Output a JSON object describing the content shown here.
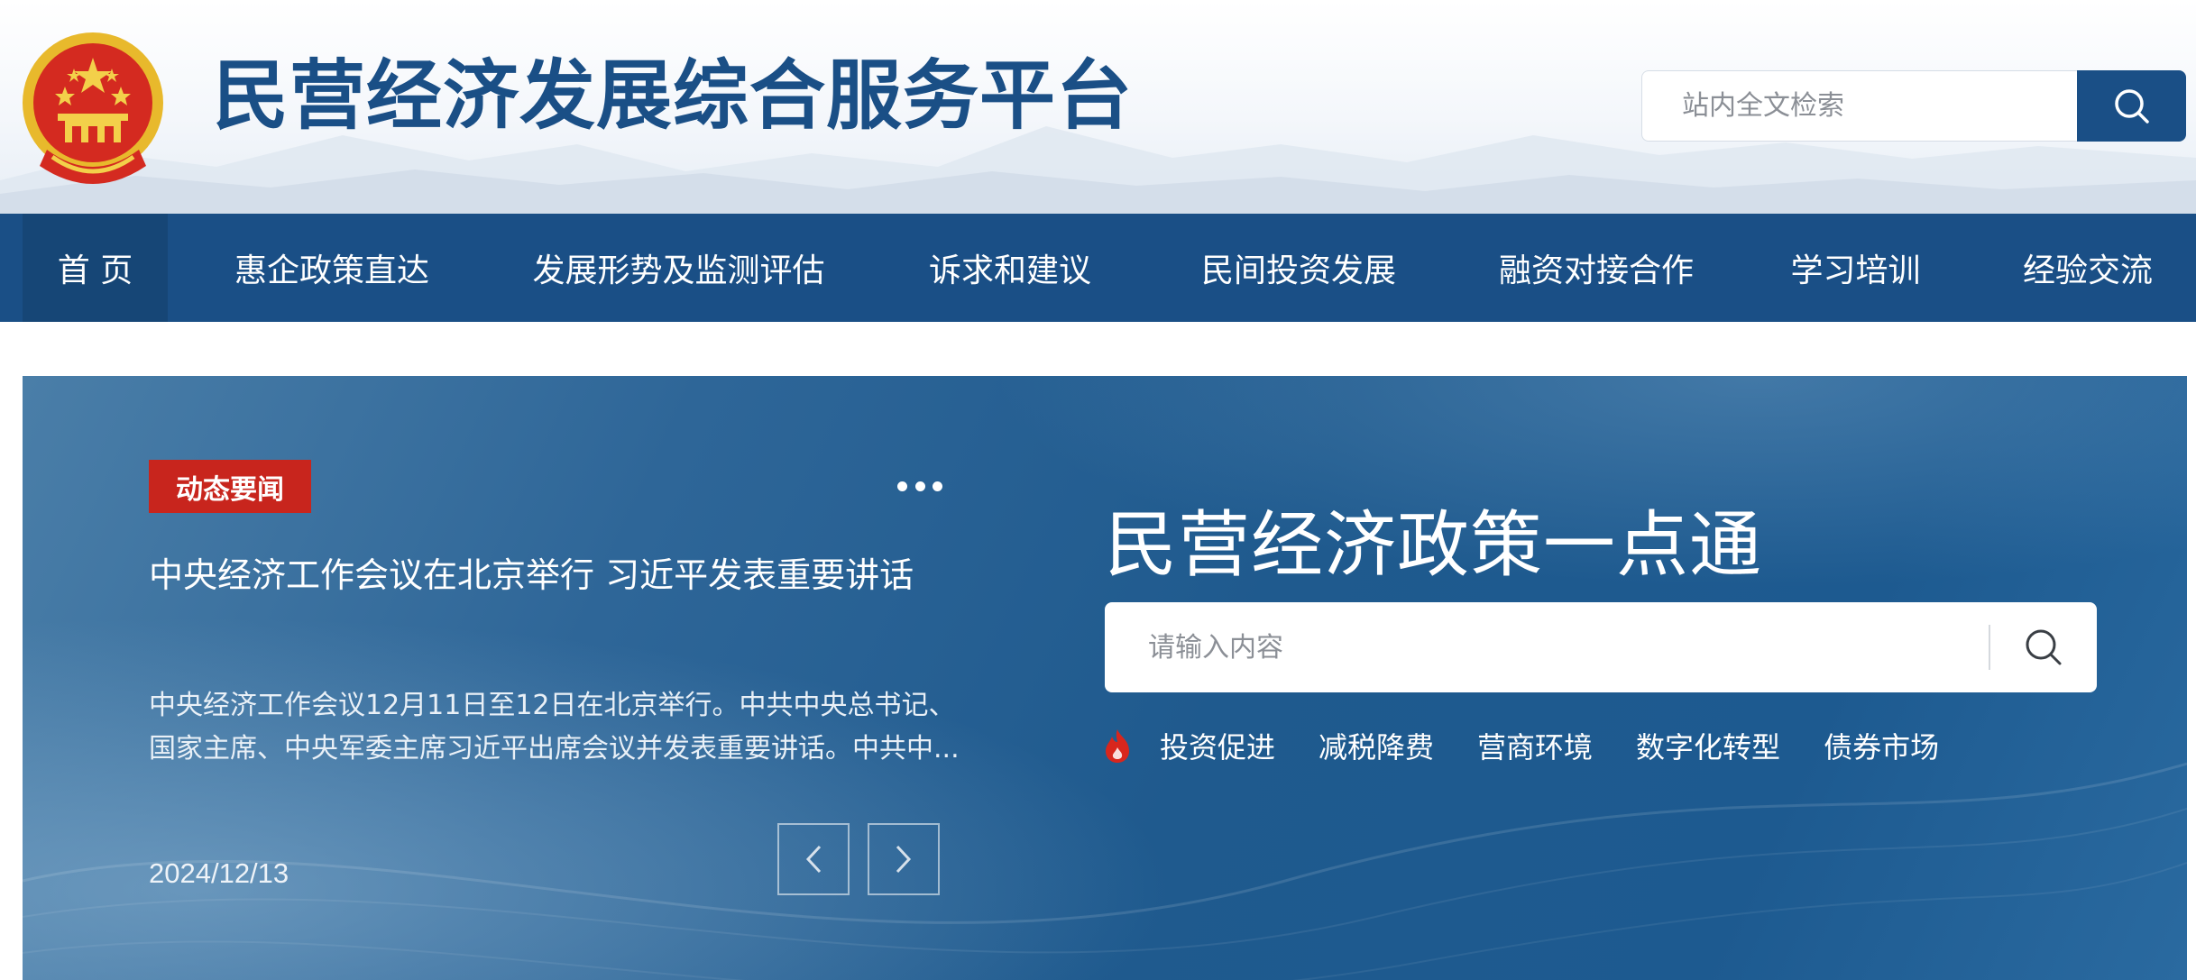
{
  "header": {
    "site_title": "民营经济发展综合服务平台",
    "search_placeholder": "站内全文检索"
  },
  "nav": {
    "items": [
      {
        "label": "首 页",
        "active": true
      },
      {
        "label": "惠企政策直达",
        "active": false
      },
      {
        "label": "发展形势及监测评估",
        "active": false
      },
      {
        "label": "诉求和建议",
        "active": false
      },
      {
        "label": "民间投资发展",
        "active": false
      },
      {
        "label": "融资对接合作",
        "active": false
      },
      {
        "label": "学习培训",
        "active": false
      },
      {
        "label": "经验交流",
        "active": false
      }
    ]
  },
  "news": {
    "badge": "动态要闻",
    "title": "中央经济工作会议在北京举行 习近平发表重要讲话",
    "summary": "中央经济工作会议12月11日至12日在北京举行。中共中央总书记、国家主席、中央军委主席习近平出席会议并发表重要讲话。中共中...",
    "date": "2024/12/13"
  },
  "policy": {
    "title": "民营经济政策一点通",
    "search_placeholder": "请输入内容",
    "hot_tags": [
      "投资促进",
      "减税降费",
      "营商环境",
      "数字化转型",
      "债券市场"
    ]
  },
  "colors": {
    "brand_blue": "#1a4f86",
    "badge_red": "#c8251d",
    "fire_red": "#d8261d"
  }
}
